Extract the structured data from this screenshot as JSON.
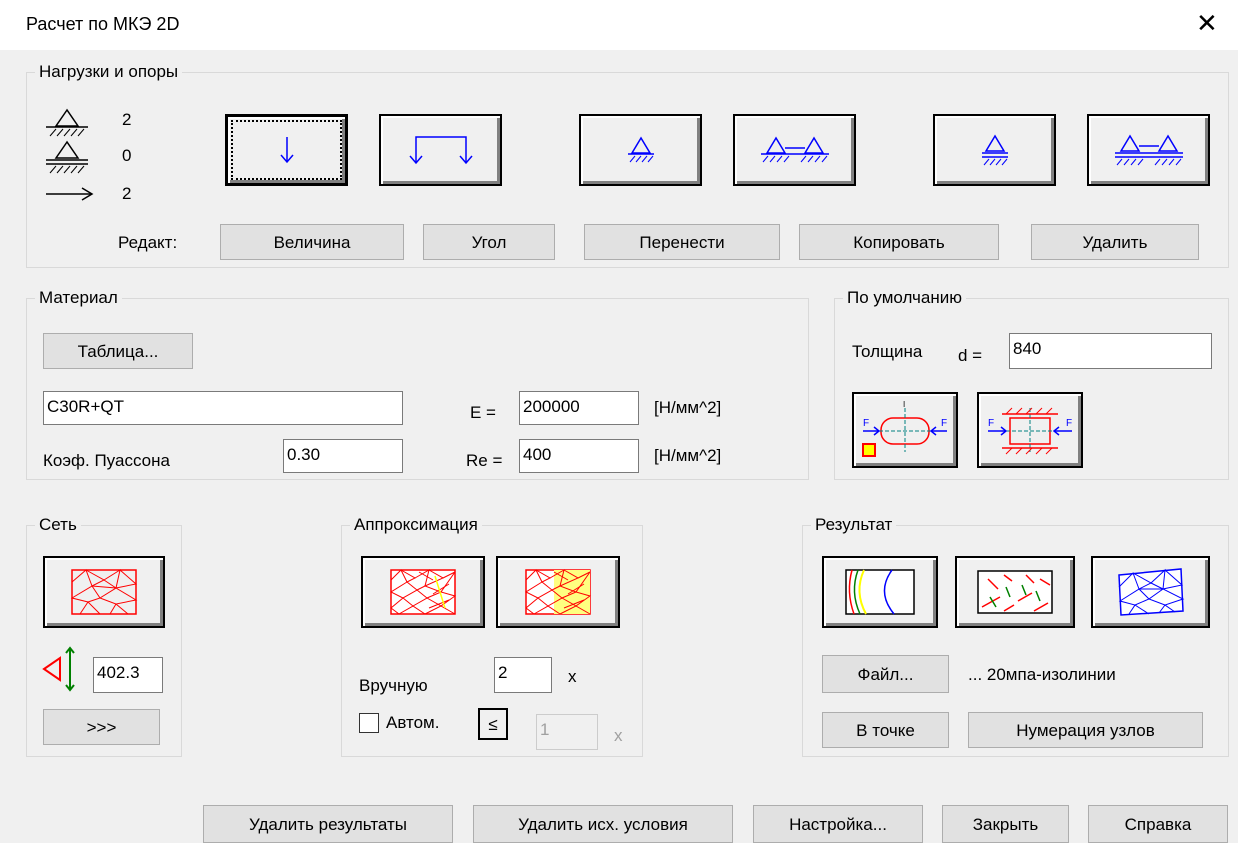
{
  "window": {
    "title": "Расчет по МКЭ 2D"
  },
  "loads": {
    "legend": "Нагрузки и опоры",
    "counts": [
      "2",
      "0",
      "2"
    ],
    "edit_label": "Редакт:",
    "edit_buttons": [
      "Величина",
      "Угол",
      "Перенести",
      "Копировать",
      "Удалить"
    ]
  },
  "material": {
    "legend": "Материал",
    "table_button": "Таблица...",
    "name": "C30R+QT",
    "poisson_label": "Коэф. Пуассона",
    "poisson": "0.30",
    "e_label": "E =",
    "e_value": "200000",
    "e_unit": "[Н/мм^2]",
    "re_label": "Re =",
    "re_value": "400",
    "re_unit": "[Н/мм^2]"
  },
  "defaults": {
    "legend": "По умолчанию",
    "thickness_label": "Толщина",
    "d_label": "d =",
    "d_value": "840"
  },
  "mesh": {
    "legend": "Сеть",
    "size_value": "402.3",
    "more_button": ">>>"
  },
  "approx": {
    "legend": "Аппроксимация",
    "manual_label": "Вручную",
    "manual_value": "2",
    "manual_unit": "x",
    "auto_label": "Автом.",
    "le_button": "≤",
    "auto_value": "1",
    "auto_unit": "x"
  },
  "result": {
    "legend": "Результат",
    "file_button": "Файл...",
    "file_name": "... 20мпа-изолинии",
    "at_point_button": "В точке",
    "node_numbering_button": "Нумерация узлов"
  },
  "footer": {
    "buttons": [
      "Удалить результаты",
      "Удалить исх. условия",
      "Настройка...",
      "Закрыть",
      "Справка"
    ]
  }
}
